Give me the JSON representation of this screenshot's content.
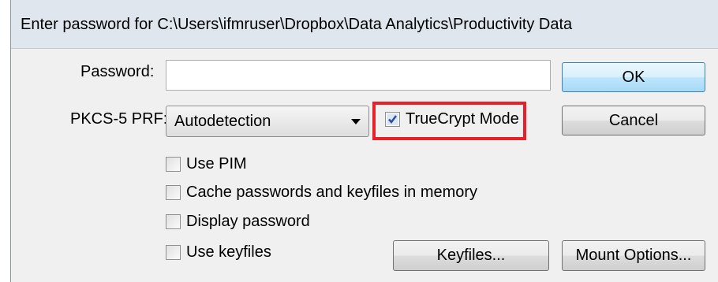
{
  "window": {
    "title": "Enter password for C:\\Users\\ifmruser\\Dropbox\\Data Analytics\\Productivity Data"
  },
  "form": {
    "password_label": "Password:",
    "password_value": "",
    "prf_label": "PKCS-5 PRF:",
    "prf_selected": "Autodetection"
  },
  "checkboxes": {
    "truecrypt_mode": {
      "label": "TrueCrypt Mode",
      "checked": true
    },
    "use_pim": {
      "label": "Use PIM",
      "checked": false
    },
    "cache_passwords": {
      "label": "Cache passwords and keyfiles in memory",
      "checked": false
    },
    "display_password": {
      "label": "Display password",
      "checked": false
    },
    "use_keyfiles": {
      "label": "Use keyfiles",
      "checked": false
    }
  },
  "buttons": {
    "ok": "OK",
    "cancel": "Cancel",
    "keyfiles": "Keyfiles...",
    "mount_options": "Mount Options..."
  },
  "colors": {
    "highlight": "#e8202a",
    "check_mark": "#2a4f9e"
  }
}
